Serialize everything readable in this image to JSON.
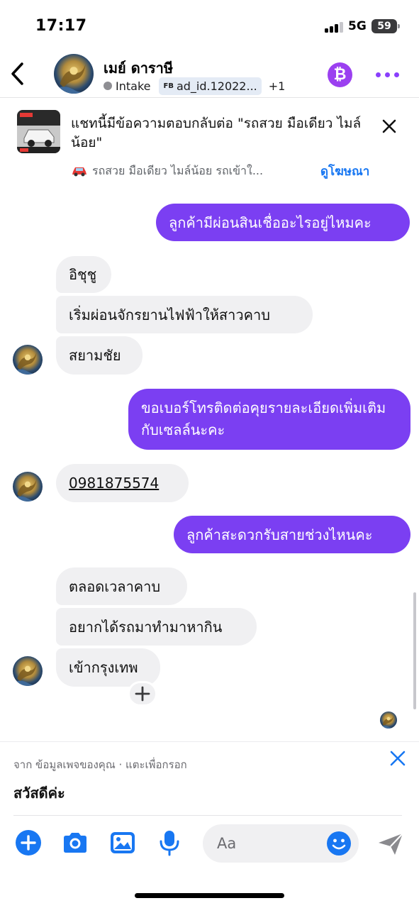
{
  "status_bar": {
    "time": "17:17",
    "network": "5G",
    "battery": "59"
  },
  "header": {
    "contact_name": "เมย์ ดาราษี",
    "stage": "Intake",
    "label_prefix": "FB",
    "label": "ad_id.12022...",
    "extra_labels": "+1",
    "pay_icon": "₿"
  },
  "ad_banner": {
    "title": "แชทนี้มีข้อความตอบกลับต่อ \"รถสวย มือเดียว ไมล์น้อย\"",
    "subtitle": "รถสวย มือเดียว ไมล์น้อย รถเข้าใ...",
    "link": "ดูโฆษณา"
  },
  "messages": [
    {
      "direction": "outgoing",
      "text": "ลูกค้ามีผ่อนสินเชื่ออะไรอยู่ไหมคะ"
    },
    {
      "direction": "incoming",
      "text": "อิชุชู"
    },
    {
      "direction": "incoming",
      "text": "เริ่มผ่อนจักรยานไฟฟ้าให้สาวคาบ"
    },
    {
      "direction": "incoming",
      "text": "สยามชัย"
    },
    {
      "direction": "outgoing",
      "text": "ขอเบอร์โทรติดต่อคุยรายละเอียดเพิ่มเติมกับเซลล์นะคะ"
    },
    {
      "direction": "incoming",
      "text": "0981875574"
    },
    {
      "direction": "outgoing",
      "text": "ลูกค้าสะดวกรับสายช่วงไหนคะ"
    },
    {
      "direction": "incoming",
      "text": "ตลอดเวลาคาบ"
    },
    {
      "direction": "incoming",
      "text": "อยากได้รถมาทำมาหากิน"
    },
    {
      "direction": "incoming",
      "text": "เข้ากรุงเทพ"
    }
  ],
  "suggestion": {
    "source": "จาก ข้อมูลเพจของคุณ · แตะเพื่อกรอก",
    "text": "สวัสดีค่ะ"
  },
  "composer": {
    "placeholder": "Aa"
  },
  "colors": {
    "accent_blue": "#1877f2",
    "outgoing_purple": "#7b3ff2",
    "incoming_gray": "#f0f0f2",
    "pay_purple": "#9b40f0"
  },
  "icons": [
    "back-arrow-icon",
    "bitcoin-icon",
    "more-icon",
    "close-icon",
    "car-icon",
    "plus-icon",
    "camera-icon",
    "image-icon",
    "microphone-icon",
    "emoji-icon",
    "send-icon"
  ]
}
